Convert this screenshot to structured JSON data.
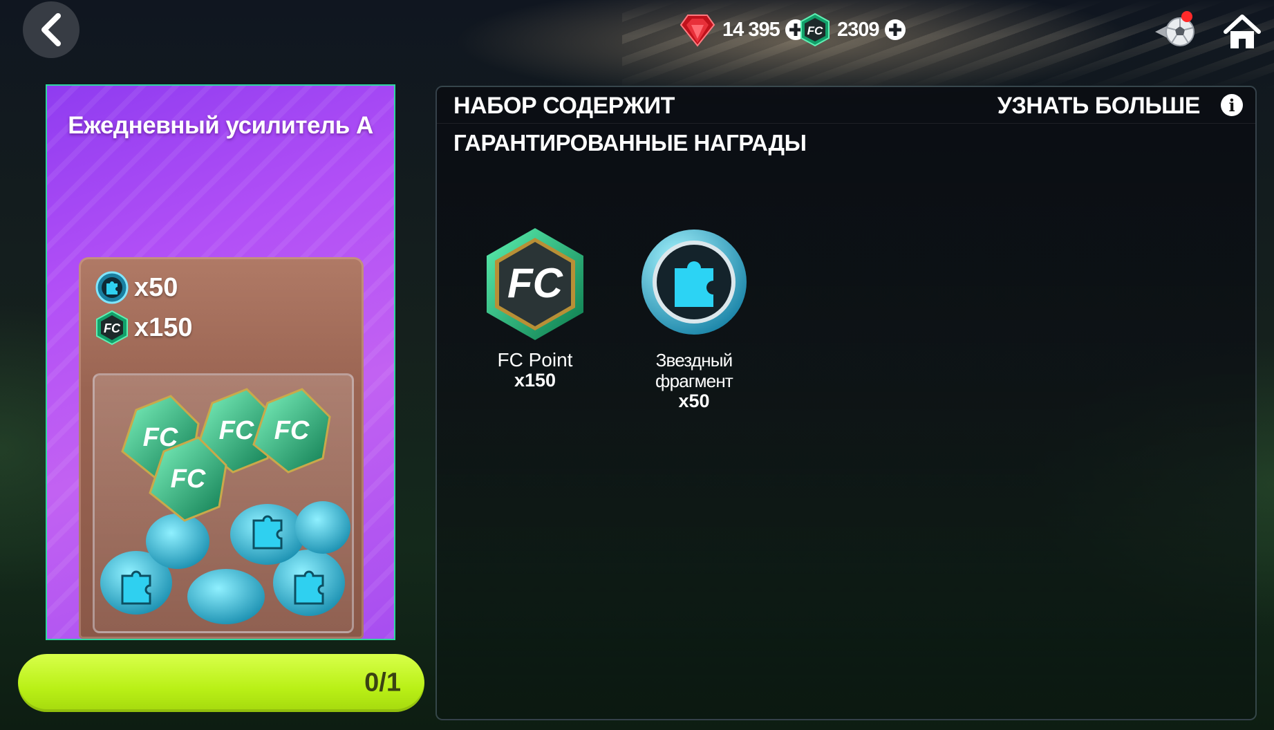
{
  "topbar": {
    "gems_value": "14 395",
    "fc_points_value": "2309"
  },
  "pack": {
    "title": "Ежедневный усилитель А",
    "contents": [
      {
        "icon": "star-fragment-icon",
        "qty": "x50"
      },
      {
        "icon": "fc-point-icon",
        "qty": "x150"
      }
    ],
    "progress_text": "0/1",
    "progress_fraction": 0
  },
  "contents_panel": {
    "title": "НАБОР СОДЕРЖИТ",
    "learn_more": "УЗНАТЬ БОЛЬШЕ",
    "section_title": "ГАРАНТИРОВАННЫЕ НАГРАДЫ",
    "rewards": [
      {
        "icon": "fc-point-icon",
        "name": "FC Point",
        "qty": "x150"
      },
      {
        "icon": "star-fragment-icon",
        "name": "Звездный фрагмент",
        "qty": "x50"
      }
    ]
  },
  "colors": {
    "pack_purple": "#b14ff6",
    "progress_lime": "#b9f016",
    "fc_green": "#1fd28f",
    "fragment_cyan": "#26c6e0",
    "gem_red": "#e0202a"
  }
}
